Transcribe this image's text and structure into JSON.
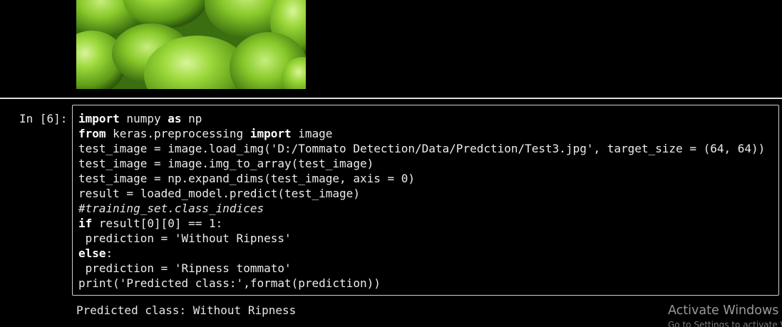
{
  "image_output": {
    "alt": "green tomatoes",
    "colors": {
      "fruit": "#8fd12e",
      "highlight": "#d9f59a",
      "shadow": "#2f5a0c"
    }
  },
  "cell": {
    "prompt": "In [6]:",
    "code_lines": [
      [
        {
          "t": "import",
          "k": "kw"
        },
        {
          "t": " numpy "
        },
        {
          "t": "as",
          "k": "kw"
        },
        {
          "t": " np"
        }
      ],
      [
        {
          "t": "from",
          "k": "kw"
        },
        {
          "t": " keras.preprocessing "
        },
        {
          "t": "import",
          "k": "kw"
        },
        {
          "t": " image"
        }
      ],
      [
        {
          "t": "test_image = image.load_img('D:/Tommato Detection/Data/Predction/Test3.jpg', target_size = (64, 64))"
        }
      ],
      [
        {
          "t": "test_image = image.img_to_array(test_image)"
        }
      ],
      [
        {
          "t": "test_image = np.expand_dims(test_image, axis = 0)"
        }
      ],
      [
        {
          "t": "result = loaded_model.predict(test_image)"
        }
      ],
      [
        {
          "t": "#training_set.class_indices",
          "k": "cm"
        }
      ],
      [
        {
          "t": "if",
          "k": "kw"
        },
        {
          "t": " result[0][0] == 1:"
        }
      ],
      [
        {
          "t": " prediction = 'Without Ripness'"
        }
      ],
      [
        {
          "t": "else",
          "k": "kw"
        },
        {
          "t": ":"
        }
      ],
      [
        {
          "t": " prediction = 'Ripness tommato'"
        }
      ],
      [
        {
          "t": "print('Predicted class:',format(prediction))"
        }
      ]
    ]
  },
  "output": {
    "text": "Predicted class: Without Ripness"
  },
  "watermark": {
    "title": "Activate Windows",
    "subtitle": "Go to Settings to activate Windows."
  }
}
